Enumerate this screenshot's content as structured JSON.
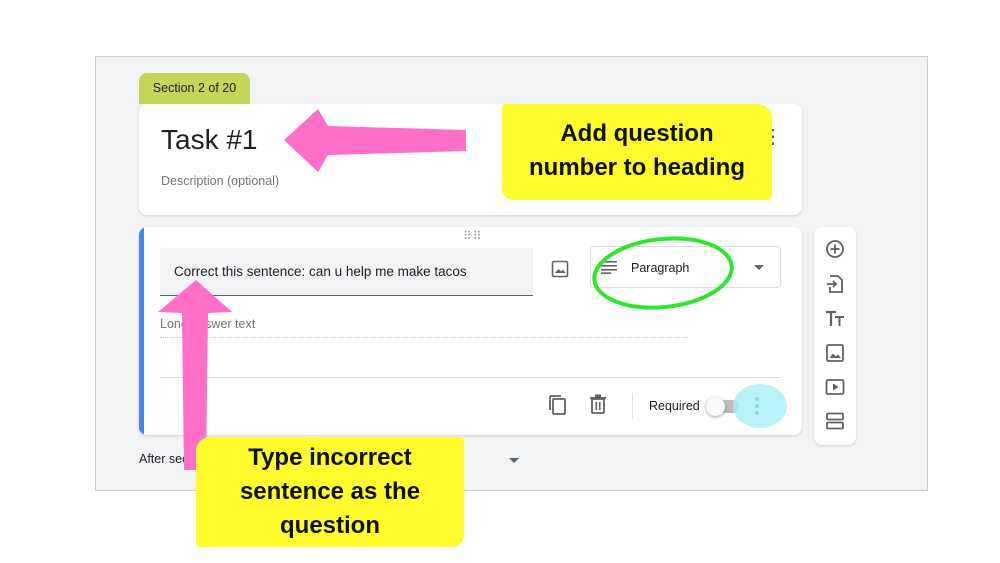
{
  "section_tab": {
    "label": "Section 2 of 20"
  },
  "header": {
    "title": "Task #1",
    "description_placeholder": "Description (optional)"
  },
  "question": {
    "text": "Correct this sentence: can u help me make tacos",
    "type_label": "Paragraph",
    "answer_placeholder": "Long answer text",
    "required_label": "Required",
    "required": false
  },
  "after_section": {
    "label": "After section 2 Continue to next section"
  },
  "annotations": {
    "top_lines": [
      "Add question",
      "number to heading"
    ],
    "bottom_lines": [
      "Type incorrect",
      "sentence as the",
      "question"
    ]
  },
  "colors": {
    "section_tab": "#c5d55a",
    "question_accent": "#4285f4",
    "annotation_highlight": "#fffb2c",
    "arrow": "#ff6ec7",
    "circle": "#2ee62e",
    "glow": "#a8f0f5"
  },
  "icons": {
    "header_more": "more-vert-icon",
    "drag": "drag-handle-icon",
    "image": "image-icon",
    "paragraph": "paragraph-lines-icon",
    "copy": "duplicate-icon",
    "delete": "trash-icon",
    "more": "more-vert-icon",
    "sidebar": [
      "add-circle-icon",
      "import-icon",
      "title-text-icon",
      "image-icon",
      "video-icon",
      "section-icon"
    ]
  }
}
